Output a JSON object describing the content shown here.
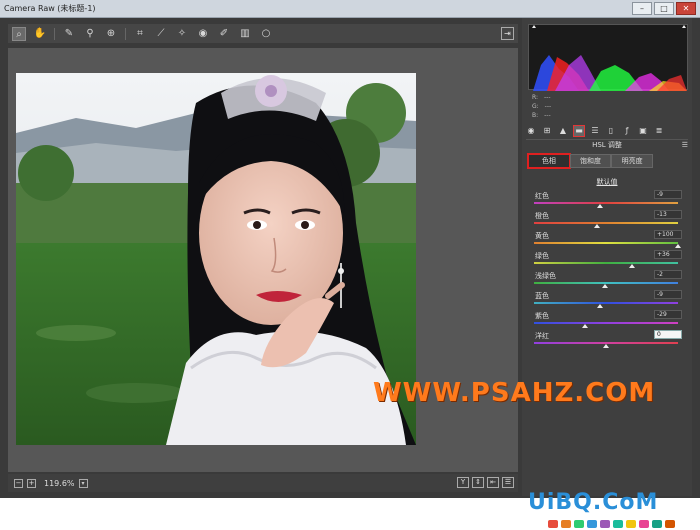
{
  "window": {
    "title": "Camera Raw (未标题-1)",
    "minimize": "–",
    "maximize": "□",
    "close": "✕"
  },
  "toolbar": {
    "tools": [
      "zoom-icon",
      "hand-icon",
      "white-balance-icon",
      "color-sampler-icon",
      "target-adjust-icon",
      "crop-icon",
      "straighten-icon",
      "spot-removal-icon",
      "red-eye-icon",
      "adjustment-brush-icon",
      "graduated-filter-icon",
      "radial-filter-icon"
    ],
    "export_icon": "export-icon"
  },
  "statusbar": {
    "zoom_minus": "−",
    "zoom_plus": "+",
    "zoom_value": "119.6%",
    "zoom_dropdown": "▾",
    "view_y": "Y",
    "view_icons": [
      "before-after-icon",
      "swap-icon",
      "settings-icon"
    ]
  },
  "histogram": {
    "readout": [
      {
        "label": "R:",
        "value": "---"
      },
      {
        "label": "G:",
        "value": "---"
      },
      {
        "label": "B:",
        "value": "---"
      }
    ]
  },
  "panel": {
    "header": "HSL 调整",
    "icons": [
      "basic-icon",
      "tone-curve-icon",
      "detail-icon",
      "hsl-icon",
      "split-toning-icon",
      "lens-icon",
      "fx-icon",
      "camera-calibration-icon",
      "presets-icon"
    ],
    "tabs": [
      {
        "label": "色相",
        "active": true
      },
      {
        "label": "饱和度",
        "active": false
      },
      {
        "label": "明亮度",
        "active": false
      }
    ],
    "default_link": "默认值",
    "sliders": [
      {
        "label": "红色",
        "value": "-9",
        "level": -9,
        "gradient": "linear-gradient(90deg,#c040c0,#e04040,#e0a040)"
      },
      {
        "label": "橙色",
        "value": "-13",
        "level": -13,
        "gradient": "linear-gradient(90deg,#e04040,#e08030,#e0d040)"
      },
      {
        "label": "黄色",
        "value": "+100",
        "level": 100,
        "gradient": "linear-gradient(90deg,#e08030,#e0e040,#60c040)"
      },
      {
        "label": "绿色",
        "value": "+36",
        "level": 36,
        "gradient": "linear-gradient(90deg,#d0d040,#40b040,#40c0a0)"
      },
      {
        "label": "浅绿色",
        "value": "-2",
        "level": -2,
        "gradient": "linear-gradient(90deg,#40b040,#40c0c0,#4080e0)"
      },
      {
        "label": "蓝色",
        "value": "-9",
        "level": -9,
        "gradient": "linear-gradient(90deg,#40b0c0,#3050e0,#9040e0)"
      },
      {
        "label": "紫色",
        "value": "-29",
        "level": -29,
        "gradient": "linear-gradient(90deg,#3050e0,#9040e0,#d040c0)"
      },
      {
        "label": "洋红",
        "value": "0",
        "level": 0,
        "gradient": "linear-gradient(90deg,#9040e0,#d040a0,#e04050)"
      }
    ]
  },
  "watermark": "WWW.PSAHZ.COM",
  "logo": {
    "text": "UiBQ.CoM",
    "strip_colors": [
      "#e74c3c",
      "#e67e22",
      "#2ecc71",
      "#3498db",
      "#9b59b6",
      "#1abc9c",
      "#f1c40f",
      "#e84393",
      "#16a085",
      "#d35400"
    ]
  },
  "colors": {
    "accent_red": "#e02020",
    "watermark": "#ff7a1c",
    "logo": "#2a8fd8"
  }
}
